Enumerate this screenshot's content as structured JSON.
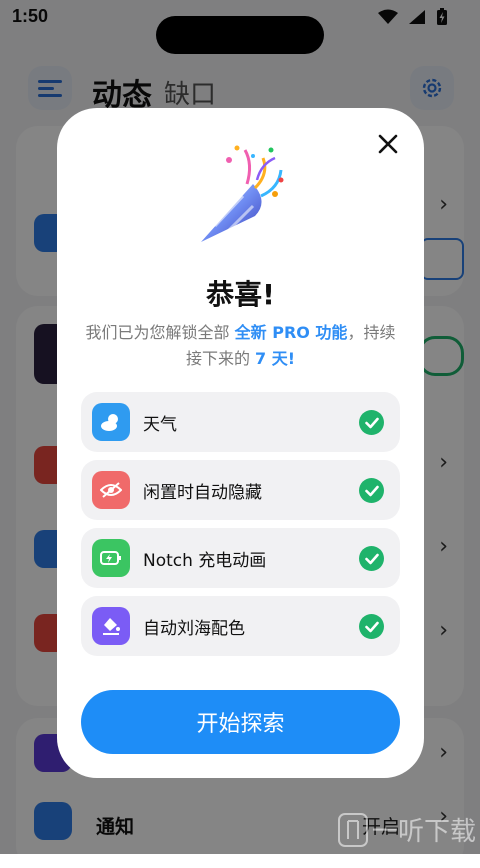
{
  "status_bar": {
    "time": "1:50"
  },
  "app": {
    "title": "动态",
    "subtitle": "缺口",
    "rows": {
      "notify_label": "通知",
      "open_label": "开启"
    }
  },
  "modal": {
    "title": "恭喜!",
    "desc_part1": "我们已为您解锁全部 ",
    "desc_highlight1": "全新 PRO 功能",
    "desc_part2": "，持续接下来的 ",
    "desc_highlight2": "7 天!",
    "features": [
      {
        "label": "天气",
        "icon": "weather-icon",
        "color": "#2f9bf0"
      },
      {
        "label": "闲置时自动隐藏",
        "icon": "eye-off-icon",
        "color": "#f06a6a"
      },
      {
        "label": "Notch 充电动画",
        "icon": "charging-icon",
        "color": "#3bc562"
      },
      {
        "label": "自动刘海配色",
        "icon": "color-fill-icon",
        "color": "#7b5cf5"
      }
    ],
    "button_label": "开始探索"
  },
  "watermark": {
    "text": "一听下载"
  },
  "colors": {
    "accent": "#1e8df7",
    "check": "#1fb36b",
    "highlight": "#2f8ef5"
  }
}
